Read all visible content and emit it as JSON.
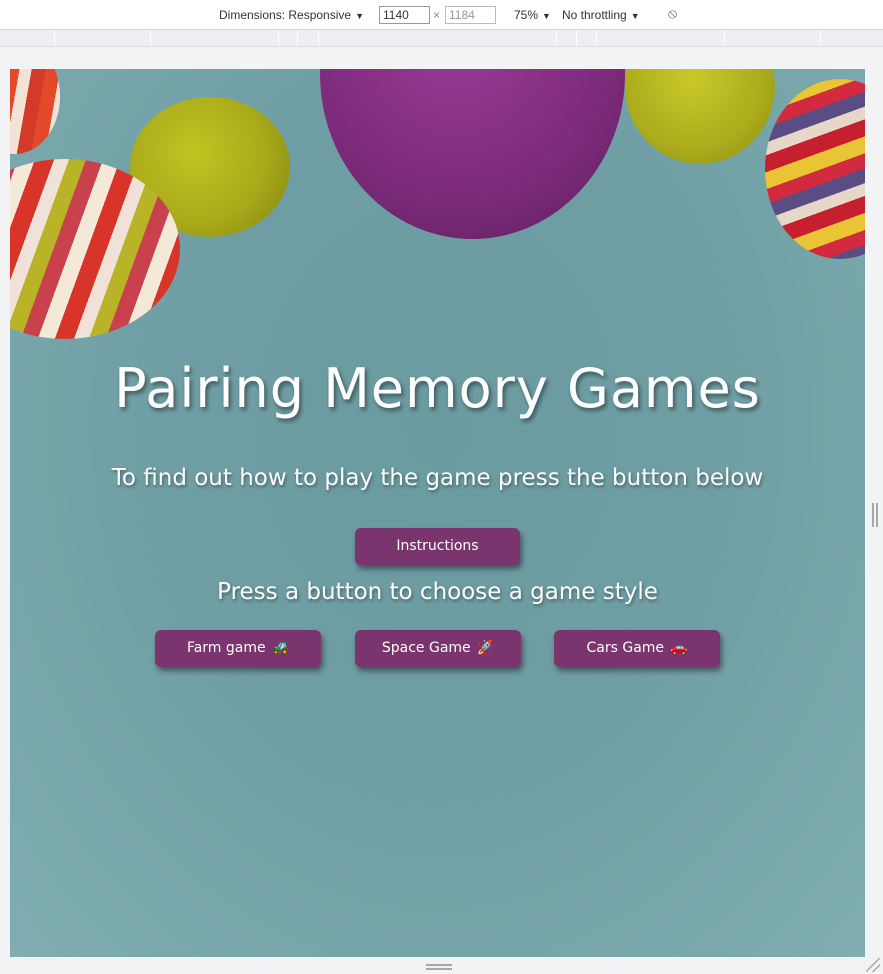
{
  "devtools": {
    "dimensions_label": "Dimensions: Responsive",
    "width_value": "1140",
    "times": "×",
    "height_placeholder": "1184",
    "zoom_label": "75%",
    "throttling_label": "No throttling",
    "caret": "▼",
    "rotate_icon": "⦸"
  },
  "hero": {
    "title": "Pairing Memory Games",
    "subtitle": "To find out how to play the game press the button below",
    "instructions_button": "Instructions",
    "choose_text": "Press a button to choose a game style"
  },
  "games": [
    {
      "label": "Farm game",
      "icon": "tractor-icon",
      "glyph": "🚜"
    },
    {
      "label": "Space Game",
      "icon": "rocket-icon",
      "glyph": "🚀"
    },
    {
      "label": "Cars Game",
      "icon": "car-icon",
      "glyph": "🚗"
    }
  ],
  "colors": {
    "button_bg": "#7b356e",
    "page_bg": "#7aa6ab",
    "text": "#ffffff"
  }
}
